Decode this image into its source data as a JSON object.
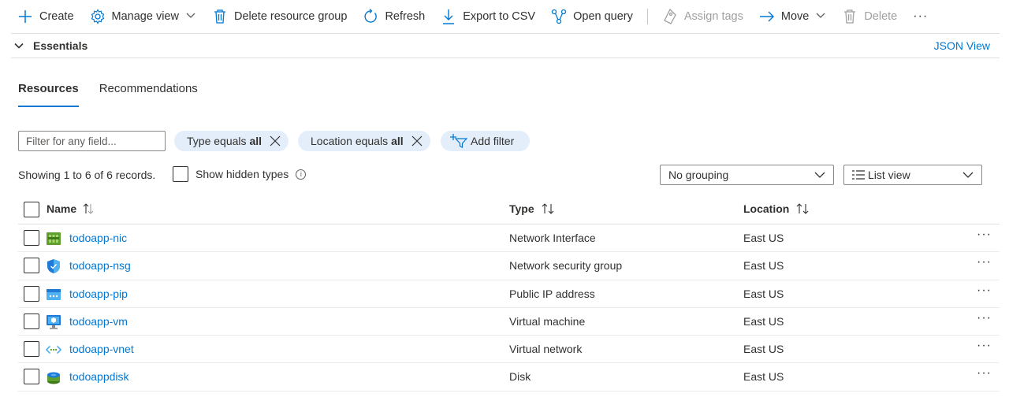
{
  "toolbar": {
    "create": "Create",
    "manage_view": "Manage view",
    "delete_group": "Delete resource group",
    "refresh": "Refresh",
    "export_csv": "Export to CSV",
    "open_query": "Open query",
    "assign_tags": "Assign tags",
    "move": "Move",
    "delete": "Delete",
    "more": "···"
  },
  "essentials": {
    "title": "Essentials",
    "json_view": "JSON View"
  },
  "tabs": [
    {
      "label": "Resources",
      "active": true
    },
    {
      "label": "Recommendations",
      "active": false
    }
  ],
  "filters": {
    "placeholder": "Filter for any field...",
    "type_prefix": "Type equals",
    "type_value": "all",
    "location_prefix": "Location equals",
    "location_value": "all",
    "add_filter": "Add filter"
  },
  "records_text": "Showing 1 to 6 of 6 records.",
  "show_hidden_types": "Show hidden types",
  "grouping": "No grouping",
  "view_mode": "List view",
  "columns": {
    "name": "Name",
    "type": "Type",
    "location": "Location"
  },
  "rows": [
    {
      "name": "todoapp-nic",
      "type": "Network Interface",
      "location": "East US",
      "icon": "network-interface-icon"
    },
    {
      "name": "todoapp-nsg",
      "type": "Network security group",
      "location": "East US",
      "icon": "network-security-group-icon"
    },
    {
      "name": "todoapp-pip",
      "type": "Public IP address",
      "location": "East US",
      "icon": "public-ip-icon"
    },
    {
      "name": "todoapp-vm",
      "type": "Virtual machine",
      "location": "East US",
      "icon": "virtual-machine-icon"
    },
    {
      "name": "todoapp-vnet",
      "type": "Virtual network",
      "location": "East US",
      "icon": "virtual-network-icon"
    },
    {
      "name": "todoappdisk",
      "type": "Disk",
      "location": "East US",
      "icon": "disk-icon"
    }
  ],
  "row_more": "···",
  "colors": {
    "accent": "#0078d4",
    "pill_bg": "#e3eefa",
    "text": "#323130",
    "disabled": "#a19f9d"
  }
}
